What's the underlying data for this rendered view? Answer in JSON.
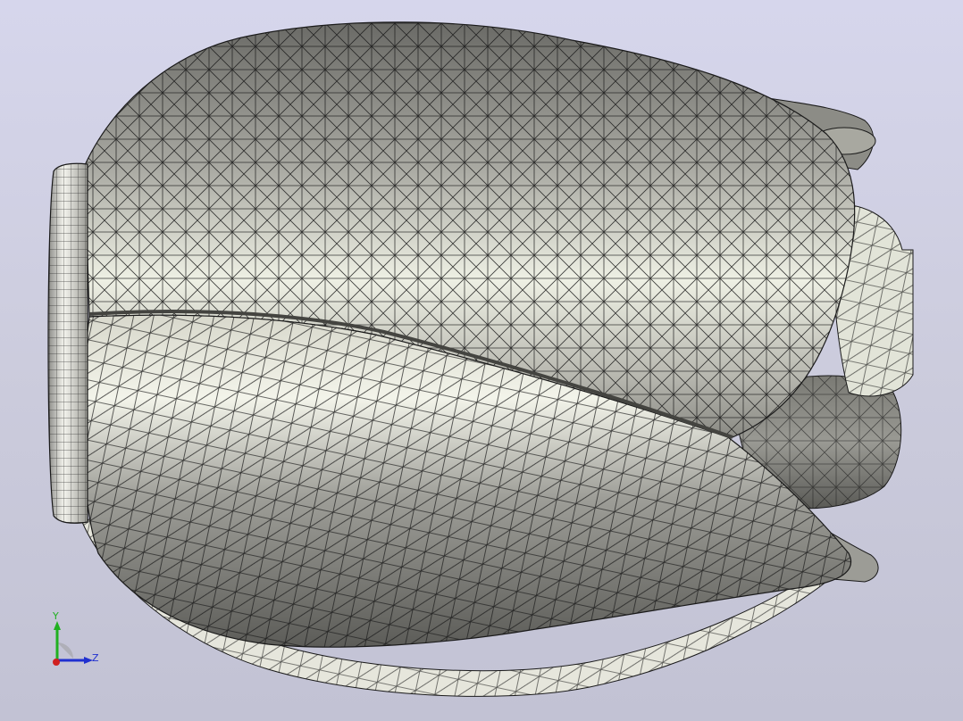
{
  "viewer": {
    "background_top": "#d6d6ec",
    "background_bottom": "#c2c2d4",
    "model_color": "#bdbdb6",
    "mesh_color": "#1a1a1a"
  },
  "triad": {
    "y_label": "Y",
    "z_label": "Z",
    "y_color": "#20b020",
    "z_color": "#2030d0",
    "x_color": "#d02020"
  }
}
